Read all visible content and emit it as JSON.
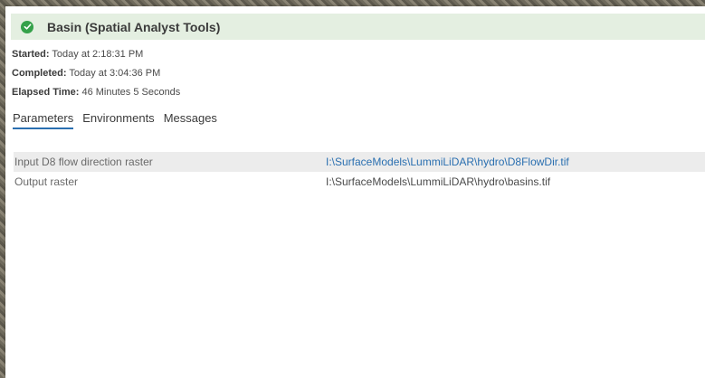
{
  "header": {
    "title": "Basin (Spatial Analyst Tools)",
    "status_icon": "check-circle-icon",
    "status_color": "#35a14a"
  },
  "meta": {
    "started_label": "Started:",
    "started_value": "Today at 2:18:31 PM",
    "completed_label": "Completed:",
    "completed_value": "Today at 3:04:36 PM",
    "elapsed_label": "Elapsed Time:",
    "elapsed_value": "46 Minutes 5 Seconds"
  },
  "tabs": [
    {
      "label": "Parameters",
      "active": true
    },
    {
      "label": "Environments",
      "active": false
    },
    {
      "label": "Messages",
      "active": false
    }
  ],
  "parameters": [
    {
      "name": "Input D8 flow direction raster",
      "value": "I:\\SurfaceModels\\LummiLiDAR\\hydro\\D8FlowDir.tif"
    },
    {
      "name": "Output raster",
      "value": "I:\\SurfaceModels\\LummiLiDAR\\hydro\\basins.tif"
    }
  ],
  "colors": {
    "accent": "#2a6fb0",
    "header_bg": "#e4efe1"
  }
}
